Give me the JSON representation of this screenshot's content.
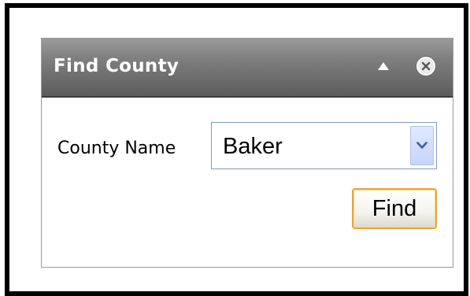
{
  "panel": {
    "title": "Find County",
    "collapse_icon": "triangle-up-icon",
    "close_icon": "close-circle-icon"
  },
  "form": {
    "county_label": "County Name",
    "county_value": "Baker",
    "dropdown_icon": "chevron-down-icon",
    "find_button_label": "Find"
  },
  "colors": {
    "titlebar_top": "#9a9a9a",
    "titlebar_bottom": "#5c5c5c",
    "button_border": "#e7a33a",
    "select_border": "#7f9db9",
    "dropdown_arrow": "#3b5db2"
  }
}
